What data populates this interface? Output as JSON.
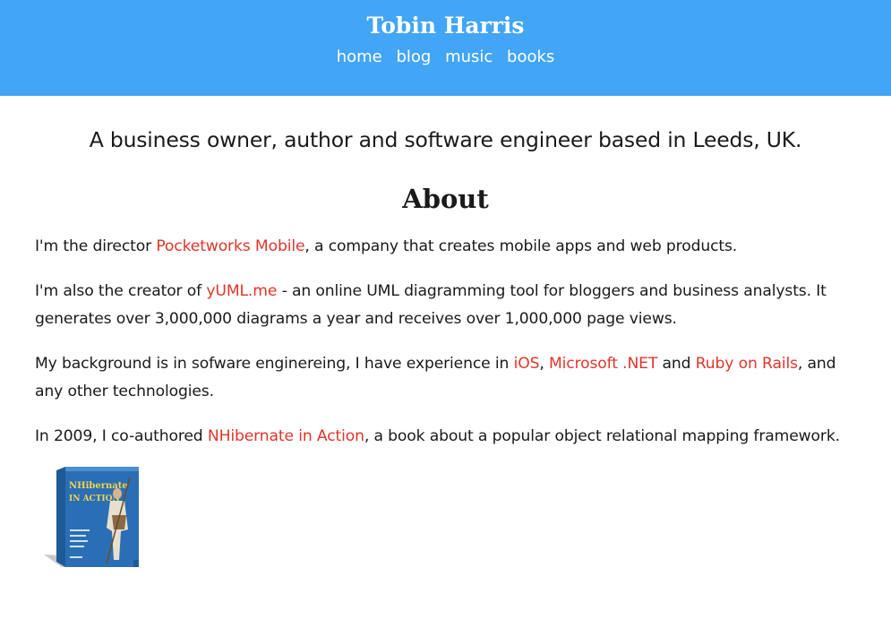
{
  "header": {
    "title": "Tobin Harris",
    "nav": [
      "home",
      "blog",
      "music",
      "books"
    ]
  },
  "tagline": "A business owner, author and software engineer based in Leeds, UK.",
  "about": {
    "heading": "About",
    "p1": {
      "before": "I'm the director ",
      "link": "Pocketworks Mobile",
      "after": ", a company that creates mobile apps and web products."
    },
    "p2": {
      "before": "I'm also the creator of ",
      "link": "yUML.me",
      "after": " - an online UML diagramming tool for bloggers and business analysts. It generates over 3,000,000 diagrams a year and receives over 1,000,000 page views."
    },
    "p3": {
      "before": "My background is in sofware enginereing, I have experience in ",
      "link1": "iOS",
      "sep1": ", ",
      "link2": "Microsoft .NET",
      "sep2": " and ",
      "link3": "Ruby on Rails",
      "after": ", and any other technologies."
    },
    "p4": {
      "before": "In 2009, I co-authored ",
      "link": "NHibernate in Action",
      "after": ", a book about a popular object relational mapping framework."
    }
  },
  "book_cover": {
    "title_line1": "NHibernate",
    "title_line2": "IN ACTION"
  },
  "colors": {
    "header_bg": "#42a5f5",
    "link": "#e0352b",
    "book_blue": "#2a6fb5"
  }
}
